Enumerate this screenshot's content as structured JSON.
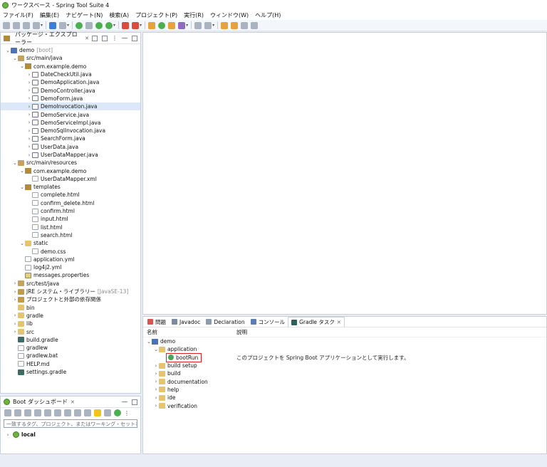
{
  "window": {
    "title": "ワークスペース - Spring Tool Suite 4"
  },
  "menu": [
    "ファイル(F)",
    "編集(E)",
    "ナビゲート(N)",
    "検索(A)",
    "プロジェクト(P)",
    "実行(R)",
    "ウィンドウ(W)",
    "ヘルプ(H)"
  ],
  "toolbar": {
    "icons": [
      "new-icon",
      "save-icon",
      "save-all-icon",
      "print-icon",
      "terminal-icon",
      "debug-skip-icon",
      "boot-run-icon",
      "debug-icon",
      "run-icon",
      "coverage-icon",
      "stop-icon",
      "external-tools-icon",
      "new-package-icon",
      "new-class-icon",
      "open-type-icon",
      "search-icon",
      "pin-icon",
      "next-annotation-icon",
      "prev-annotation-icon",
      "back-icon",
      "forward-icon",
      "open-perspective-icon"
    ]
  },
  "explorer": {
    "title": "パッケージ・エクスプローラー",
    "items": [
      {
        "label": "demo",
        "suffix": "[boot]",
        "depth": 0,
        "icon": "project-icon",
        "twisty": "v"
      },
      {
        "label": "src/main/java",
        "depth": 1,
        "icon": "package-folder-icon",
        "twisty": "v"
      },
      {
        "label": "com.example.demo",
        "depth": 2,
        "icon": "package-icon",
        "twisty": "v"
      },
      {
        "label": "DateCheckUtil.java",
        "depth": 3,
        "icon": "java-file-icon",
        "twisty": ">"
      },
      {
        "label": "DemoApplication.java",
        "depth": 3,
        "icon": "java-file-icon",
        "twisty": ">"
      },
      {
        "label": "DemoController.java",
        "depth": 3,
        "icon": "java-file-icon",
        "twisty": ">"
      },
      {
        "label": "DemoForm.java",
        "depth": 3,
        "icon": "java-file-icon",
        "twisty": ">"
      },
      {
        "label": "DemoInvocation.java",
        "depth": 3,
        "icon": "java-file-icon",
        "twisty": ">",
        "selected": true
      },
      {
        "label": "DemoService.java",
        "depth": 3,
        "icon": "interface-file-icon",
        "twisty": ">"
      },
      {
        "label": "DemoServiceImpl.java",
        "depth": 3,
        "icon": "java-file-icon",
        "twisty": ">"
      },
      {
        "label": "DemoSqlInvocation.java",
        "depth": 3,
        "icon": "java-file-icon",
        "twisty": ">"
      },
      {
        "label": "SearchForm.java",
        "depth": 3,
        "icon": "java-file-icon",
        "twisty": ">"
      },
      {
        "label": "UserData.java",
        "depth": 3,
        "icon": "java-file-icon",
        "twisty": ">"
      },
      {
        "label": "UserDataMapper.java",
        "depth": 3,
        "icon": "interface-file-icon",
        "twisty": ">"
      },
      {
        "label": "src/main/resources",
        "depth": 1,
        "icon": "package-folder-icon",
        "twisty": "v"
      },
      {
        "label": "com.example.demo",
        "depth": 2,
        "icon": "package-icon",
        "twisty": "v"
      },
      {
        "label": "UserDataMapper.xml",
        "depth": 3,
        "icon": "xml-file-icon",
        "twisty": ""
      },
      {
        "label": "templates",
        "depth": 2,
        "icon": "package-icon",
        "twisty": "v"
      },
      {
        "label": "complete.html",
        "depth": 3,
        "icon": "html-file-icon",
        "twisty": ""
      },
      {
        "label": "confirm_delete.html",
        "depth": 3,
        "icon": "html-file-icon",
        "twisty": ""
      },
      {
        "label": "confirm.html",
        "depth": 3,
        "icon": "html-file-icon",
        "twisty": ""
      },
      {
        "label": "input.html",
        "depth": 3,
        "icon": "html-file-icon",
        "twisty": ""
      },
      {
        "label": "list.html",
        "depth": 3,
        "icon": "html-file-icon",
        "twisty": ""
      },
      {
        "label": "search.html",
        "depth": 3,
        "icon": "html-file-icon",
        "twisty": ""
      },
      {
        "label": "static",
        "depth": 2,
        "icon": "folder-icon",
        "twisty": "v"
      },
      {
        "label": "demo.css",
        "depth": 3,
        "icon": "css-file-icon",
        "twisty": ""
      },
      {
        "label": "application.yml",
        "depth": 2,
        "icon": "yml-file-icon",
        "twisty": ""
      },
      {
        "label": "log4j2.yml",
        "depth": 2,
        "icon": "yml-file-icon",
        "twisty": ""
      },
      {
        "label": "messages.properties",
        "depth": 2,
        "icon": "properties-file-icon",
        "twisty": ""
      },
      {
        "label": "src/test/java",
        "depth": 1,
        "icon": "package-folder-icon",
        "twisty": ">"
      },
      {
        "label": "JRE システム・ライブラリー",
        "suffix": "[JavaSE-13]",
        "depth": 1,
        "icon": "library-icon",
        "twisty": ">"
      },
      {
        "label": "プロジェクトと外部の依存関係",
        "depth": 1,
        "icon": "library-icon",
        "twisty": ">"
      },
      {
        "label": "bin",
        "depth": 1,
        "icon": "folder-icon",
        "twisty": ""
      },
      {
        "label": "gradle",
        "depth": 1,
        "icon": "folder-icon",
        "twisty": ">"
      },
      {
        "label": "lib",
        "depth": 1,
        "icon": "folder-icon",
        "twisty": ">"
      },
      {
        "label": "src",
        "depth": 1,
        "icon": "folder-icon",
        "twisty": ">"
      },
      {
        "label": "build.gradle",
        "depth": 1,
        "icon": "gradle-file-icon",
        "twisty": ""
      },
      {
        "label": "gradlew",
        "depth": 1,
        "icon": "text-file-icon",
        "twisty": ""
      },
      {
        "label": "gradlew.bat",
        "depth": 1,
        "icon": "text-file-icon",
        "twisty": ""
      },
      {
        "label": "HELP.md",
        "depth": 1,
        "icon": "md-file-icon",
        "twisty": ""
      },
      {
        "label": "settings.gradle",
        "depth": 1,
        "icon": "gradle-file-icon",
        "twisty": ""
      }
    ]
  },
  "boot": {
    "title": "Boot ダッシュボード",
    "search_placeholder": "一致するタグ、プロジェクト、またはワーキング・セット名を入力して",
    "local_label": "local"
  },
  "bottom": {
    "tabs": [
      "問題",
      "Javadoc",
      "Declaration",
      "コンソール",
      "Gradle タスク"
    ],
    "active_tab": 4,
    "col_name": "名前",
    "col_desc": "説明",
    "tasks": [
      {
        "label": "demo",
        "depth": 0,
        "icon": "project-icon",
        "twisty": "v"
      },
      {
        "label": "application",
        "depth": 1,
        "icon": "task-folder-icon",
        "twisty": "v"
      },
      {
        "label": "bootRun",
        "depth": 2,
        "icon": "gradle-task-icon",
        "twisty": "",
        "highlight": true,
        "desc": "このプロジェクトを Spring Boot アプリケーションとして実行します。"
      },
      {
        "label": "build setup",
        "depth": 1,
        "icon": "task-folder-icon",
        "twisty": ">"
      },
      {
        "label": "build",
        "depth": 1,
        "icon": "task-folder-icon",
        "twisty": ">"
      },
      {
        "label": "documentation",
        "depth": 1,
        "icon": "task-folder-icon",
        "twisty": ">"
      },
      {
        "label": "help",
        "depth": 1,
        "icon": "task-folder-icon",
        "twisty": ">"
      },
      {
        "label": "ide",
        "depth": 1,
        "icon": "task-folder-icon",
        "twisty": ">"
      },
      {
        "label": "verification",
        "depth": 1,
        "icon": "task-folder-icon",
        "twisty": ">"
      }
    ]
  },
  "colors": {
    "highlight_box": "#e02020",
    "selection": "#dce8f8",
    "spring_green": "#6db33f"
  }
}
